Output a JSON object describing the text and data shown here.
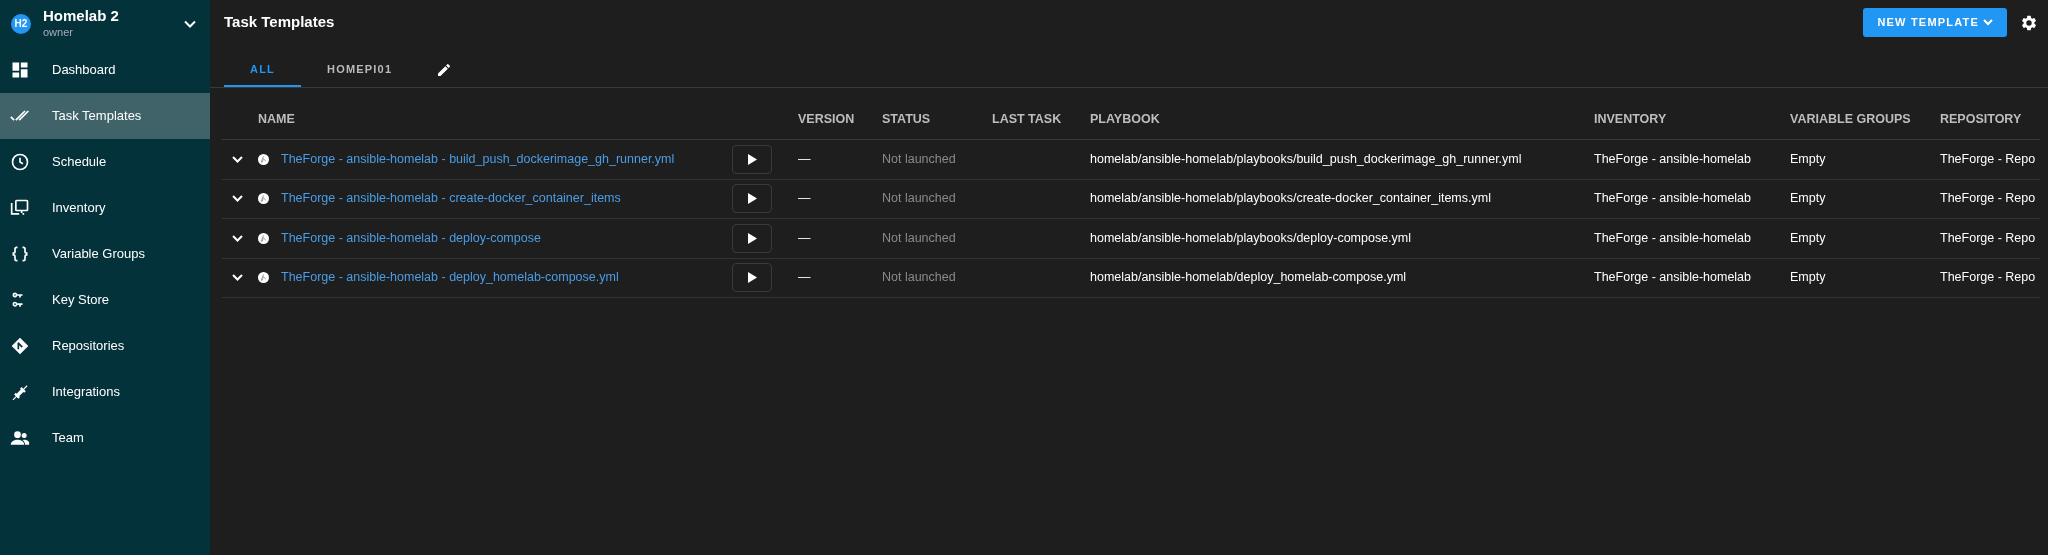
{
  "workspace": {
    "avatar": "H2",
    "name": "Homelab 2",
    "role": "owner"
  },
  "nav": [
    {
      "kind": "dashboard",
      "label": "Dashboard",
      "selected": false
    },
    {
      "kind": "templates",
      "label": "Task Templates",
      "selected": true
    },
    {
      "kind": "schedule",
      "label": "Schedule",
      "selected": false
    },
    {
      "kind": "inventory",
      "label": "Inventory",
      "selected": false
    },
    {
      "kind": "variables",
      "label": "Variable Groups",
      "selected": false
    },
    {
      "kind": "keys",
      "label": "Key Store",
      "selected": false
    },
    {
      "kind": "repositories",
      "label": "Repositories",
      "selected": false
    },
    {
      "kind": "integrations",
      "label": "Integrations",
      "selected": false
    },
    {
      "kind": "team",
      "label": "Team",
      "selected": false
    }
  ],
  "page_title": "Task Templates",
  "new_template_button": "NEW TEMPLATE",
  "tabs": [
    {
      "label": "ALL",
      "selected": true
    },
    {
      "label": "HOMEPI01",
      "selected": false
    }
  ],
  "table": {
    "columns": [
      "NAME",
      "VERSION",
      "STATUS",
      "LAST TASK",
      "PLAYBOOK",
      "INVENTORY",
      "VARIABLE GROUPS",
      "REPOSITORY"
    ],
    "rows": [
      {
        "name": "TheForge - ansible-homelab - build_push_dockerimage_gh_runner.yml",
        "version": "—",
        "status": "Not launched",
        "playbook": "homelab/ansible-homelab/playbooks/build_push_dockerimage_gh_runner.yml",
        "inventory": "TheForge - ansible-homelab",
        "variable_groups": "Empty",
        "repository": "TheForge - Repo"
      },
      {
        "name": "TheForge - ansible-homelab - create-docker_container_items",
        "version": "—",
        "status": "Not launched",
        "playbook": "homelab/ansible-homelab/playbooks/create-docker_container_items.yml",
        "inventory": "TheForge - ansible-homelab",
        "variable_groups": "Empty",
        "repository": "TheForge - Repo"
      },
      {
        "name": "TheForge - ansible-homelab - deploy-compose",
        "version": "—",
        "status": "Not launched",
        "playbook": "homelab/ansible-homelab/playbooks/deploy-compose.yml",
        "inventory": "TheForge - ansible-homelab",
        "variable_groups": "Empty",
        "repository": "TheForge - Repo"
      },
      {
        "name": "TheForge - ansible-homelab - deploy_homelab-compose.yml",
        "version": "—",
        "status": "Not launched",
        "playbook": "homelab/ansible-homelab/deploy_homelab-compose.yml",
        "inventory": "TheForge - ansible-homelab",
        "variable_groups": "Empty",
        "repository": "TheForge - Repo"
      }
    ]
  }
}
